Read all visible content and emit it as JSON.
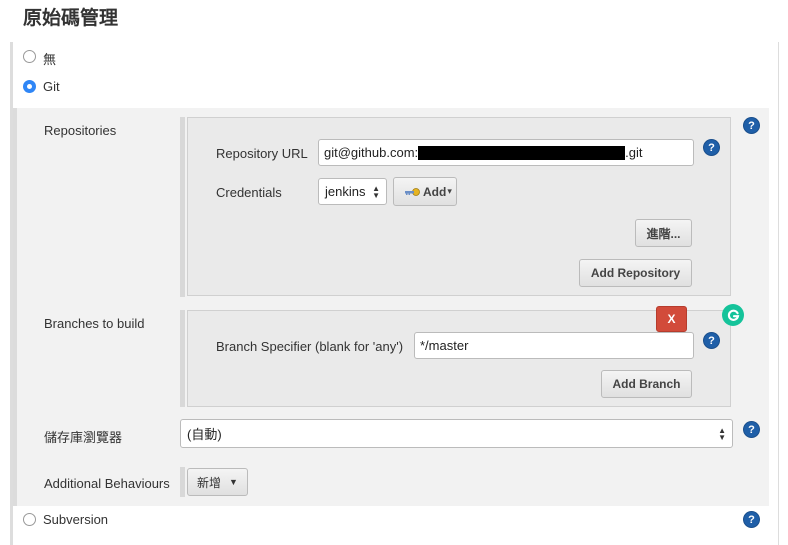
{
  "header": {
    "title": "原始碼管理"
  },
  "scm_options": {
    "none_label": "無",
    "git_label": "Git",
    "subversion_label": "Subversion"
  },
  "repositories": {
    "section_label": "Repositories",
    "url_label": "Repository URL",
    "url_value_prefix": "git@github.com:",
    "url_value_suffix": ".git",
    "credentials_label": "Credentials",
    "credentials_value": "jenkins",
    "add_label": "Add",
    "advanced_label": "進階...",
    "add_repository_label": "Add Repository"
  },
  "branches": {
    "section_label": "Branches to build",
    "delete_label": "X",
    "specifier_label": "Branch Specifier (blank for 'any')",
    "specifier_value": "*/master",
    "add_branch_label": "Add Branch"
  },
  "browser": {
    "label": "儲存庫瀏覽器",
    "value": "(自動)"
  },
  "behaviours": {
    "label": "Additional Behaviours",
    "add_label": "新增"
  },
  "help_glyph": "?",
  "colors": {
    "help_blue": "#1f5fa8",
    "radio_selected": "#2f86f6",
    "delete_red": "#d24b3a",
    "grammarly_green": "#15c39a"
  }
}
